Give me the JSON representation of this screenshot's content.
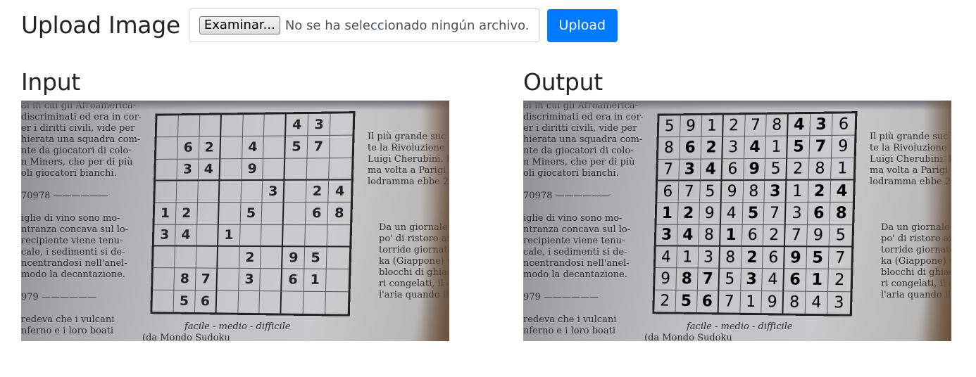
{
  "header": {
    "title": "Upload Image",
    "file_button_label": "Examinar...",
    "file_status": "No se ha seleccionado ningún archivo.",
    "upload_label": "Upload"
  },
  "input_panel": {
    "title": "Input"
  },
  "output_panel": {
    "title": "Output"
  },
  "colors": {
    "primary": "#007bff",
    "text": "#212529",
    "border": "#ced4da"
  },
  "photo_text": {
    "left_lines": [
      "ai in cui gli Afroamerica-",
      "discriminati ed era in cor-",
      "er i diritti civili, vide per",
      "hierata una squadra com-",
      "nte da giocatori di colo-",
      "n Miners, che per di più",
      "oli giocatori bianchi.",
      "",
      "70978 ——————",
      "",
      "iglie di vino sono mo-",
      "ntranza concava sul lo-",
      "recipiente viene tenu-",
      "cale, i sedimenti si de-",
      "ncentrandosi nell'anel-",
      "modo la decantazione.",
      "",
      "979 ——————",
      "",
      "redeva che i vulcani",
      "nferno e i loro boati"
    ],
    "right_lines_1": [
      "Il più grande suc",
      "te la Rivoluzione F",
      "Luigi Cherubini. R",
      "ma volta a Parigi i",
      "lodramma ebbe 20"
    ],
    "right_lines_2": [
      "Da un giornale c",
      "po' di ristoro ai p",
      "torride giornate e",
      "ka (Giappone) usa",
      "blocchi di ghiacci",
      "ri congelati, il cu",
      "l'aria quando il p"
    ],
    "difficulty": "facile - medio - difficile",
    "source": "(da Mondo Sudoku"
  },
  "input_grid": [
    [
      "",
      "",
      "",
      "",
      "",
      "",
      "4",
      "3",
      ""
    ],
    [
      "",
      "6",
      "2",
      "",
      "4",
      "",
      "5",
      "7",
      ""
    ],
    [
      "",
      "3",
      "4",
      "",
      "9",
      "",
      "",
      "",
      ""
    ],
    [
      "",
      "",
      "",
      "",
      "",
      "3",
      "",
      "2",
      "4"
    ],
    [
      "1",
      "2",
      "",
      "",
      "5",
      "",
      "",
      "6",
      "8"
    ],
    [
      "3",
      "4",
      "",
      "1",
      "",
      "",
      "",
      "",
      ""
    ],
    [
      "",
      "",
      "",
      "",
      "2",
      "",
      "9",
      "5",
      ""
    ],
    [
      "",
      "8",
      "7",
      "",
      "3",
      "",
      "6",
      "1",
      ""
    ],
    [
      "",
      "5",
      "6",
      "",
      "",
      "",
      "",
      "",
      ""
    ]
  ],
  "output_grid": [
    [
      "5",
      "9",
      "1",
      "2",
      "7",
      "8",
      "4",
      "3",
      "6"
    ],
    [
      "8",
      "6",
      "2",
      "3",
      "4",
      "1",
      "5",
      "7",
      "9"
    ],
    [
      "7",
      "3",
      "4",
      "6",
      "9",
      "5",
      "2",
      "8",
      "1"
    ],
    [
      "6",
      "7",
      "5",
      "9",
      "8",
      "3",
      "1",
      "2",
      "4"
    ],
    [
      "1",
      "2",
      "9",
      "4",
      "5",
      "7",
      "3",
      "6",
      "8"
    ],
    [
      "3",
      "4",
      "8",
      "1",
      "6",
      "2",
      "7",
      "9",
      "5"
    ],
    [
      "4",
      "1",
      "3",
      "8",
      "2",
      "6",
      "9",
      "5",
      "7"
    ],
    [
      "9",
      "8",
      "7",
      "5",
      "3",
      "4",
      "6",
      "1",
      "2"
    ],
    [
      "2",
      "5",
      "6",
      "7",
      "1",
      "9",
      "8",
      "4",
      "3"
    ]
  ]
}
